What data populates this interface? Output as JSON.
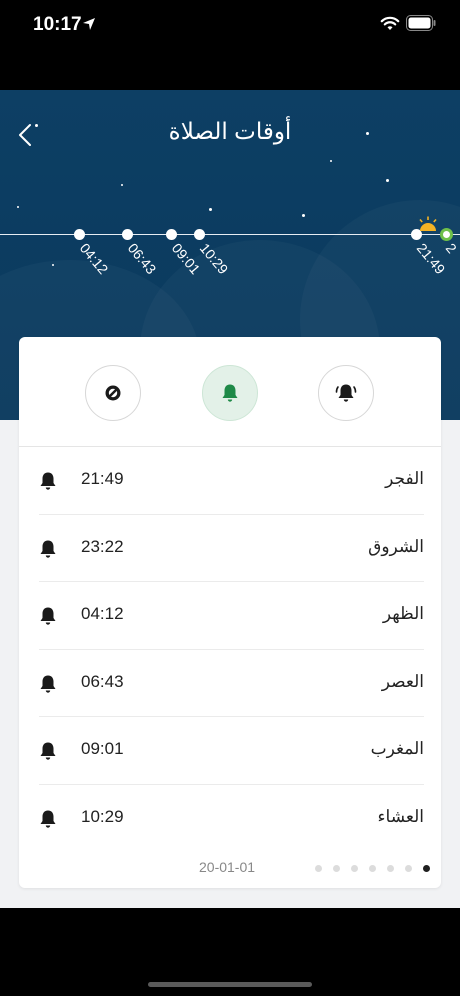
{
  "status_bar": {
    "time": "10:17"
  },
  "header": {
    "title": "أوقات الصلاة"
  },
  "timeline": {
    "labels": [
      "04:12",
      "06:43",
      "09:01",
      "10:29",
      "21:49",
      "2"
    ]
  },
  "prayers": [
    {
      "name": "الفجر",
      "time": "21:49"
    },
    {
      "name": "الشروق",
      "time": "23:22"
    },
    {
      "name": "الظهر",
      "time": "04:12"
    },
    {
      "name": "العصر",
      "time": "06:43"
    },
    {
      "name": "المغرب",
      "time": "09:01"
    },
    {
      "name": "العشاء",
      "time": "10:29"
    }
  ],
  "footer": {
    "date": "20-01-01",
    "page_count": 7,
    "active_page": 7
  },
  "colors": {
    "header_bg": "#0d3f64",
    "accent_green": "#1f8a48",
    "active_mode_bg": "#e3f1e8"
  },
  "icons": {
    "back": "chevron-left-icon",
    "mode_silent": "block-icon",
    "mode_notify": "bell-icon",
    "mode_alarm": "alarm-bell-icon",
    "row": "bell-icon"
  }
}
